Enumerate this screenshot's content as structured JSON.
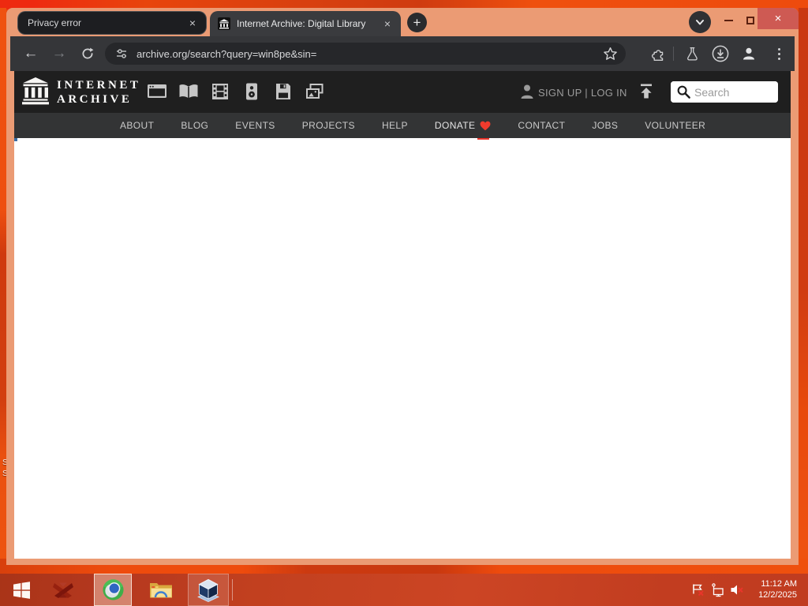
{
  "browser": {
    "tabs": [
      {
        "title": "Privacy error"
      },
      {
        "title": "Internet Archive: Digital Library"
      }
    ],
    "url": "archive.org/search?query=win8pe&sin="
  },
  "archive": {
    "brand_line1": "INTERNET",
    "brand_line2": "ARCHIVE",
    "signup_login": "SIGN UP | LOG IN",
    "search_placeholder": "Search",
    "nav": [
      {
        "label": "ABOUT"
      },
      {
        "label": "BLOG"
      },
      {
        "label": "EVENTS"
      },
      {
        "label": "PROJECTS"
      },
      {
        "label": "HELP"
      },
      {
        "label": "DONATE"
      },
      {
        "label": "CONTACT"
      },
      {
        "label": "JOBS"
      },
      {
        "label": "VOLUNTEER"
      }
    ]
  },
  "taskbar": {
    "time": "11:12 AM",
    "date": "12/2/2025"
  },
  "desktop": {
    "icon_label_1": "S",
    "icon_label_2": "S"
  },
  "icons": {
    "close": "×",
    "new_tab": "+",
    "back": "←",
    "forward": "→"
  },
  "colors": {
    "desktop_orange": "#e8470e",
    "taskbar_red": "#c2401f",
    "window_frame_salmon": "#eb9b74",
    "toolbar_dark": "#353639",
    "header_dark": "#1f1f1f",
    "navbar_gray": "#333435",
    "donate_heart_red": "#ef3b2d",
    "close_button_red": "#ce5a53"
  }
}
